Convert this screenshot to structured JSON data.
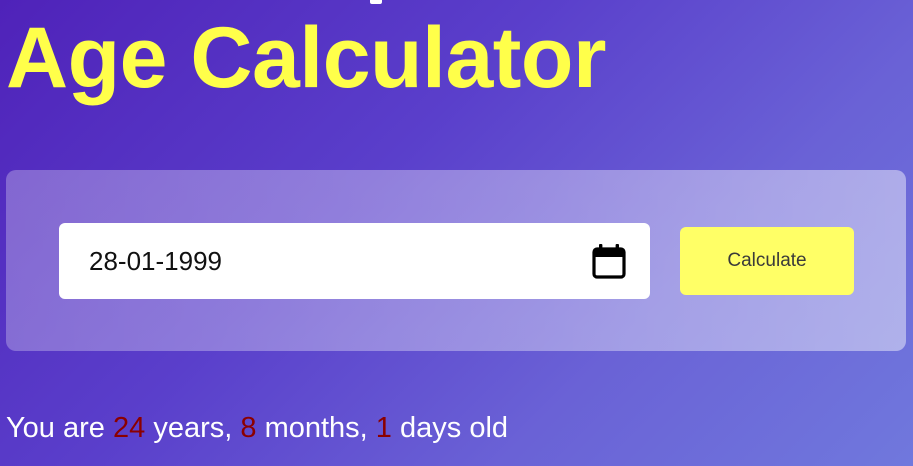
{
  "header": {
    "title": "Age Calculator"
  },
  "form": {
    "date_value": "28-01-1999",
    "calculate_label": "Calculate"
  },
  "result": {
    "prefix": "You are",
    "years": "24",
    "years_label": "years,",
    "months": "8",
    "months_label": "months,",
    "days": "1",
    "days_label": "days old"
  },
  "colors": {
    "title": "#ffff4a",
    "button": "#ffff66",
    "numbers": "#8b0000",
    "background_start": "#4f22b9",
    "background_end": "#7078dd"
  },
  "icons": {
    "date_picker": "calendar-icon"
  }
}
